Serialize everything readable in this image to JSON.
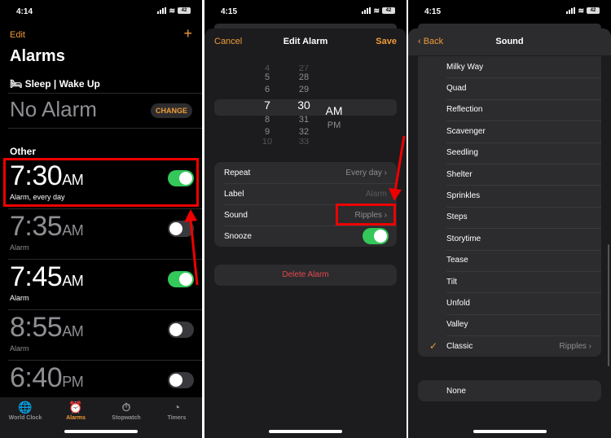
{
  "panel1": {
    "status": {
      "time": "4:14",
      "battery": "42"
    },
    "edit": "Edit",
    "add": "+",
    "title": "Alarms",
    "sleep_header": "🛏 Sleep | Wake Up",
    "no_alarm": "No Alarm",
    "change": "CHANGE",
    "other": "Other",
    "alarms": [
      {
        "time": "7:30",
        "ampm": "AM",
        "label": "Alarm, every day",
        "on": true
      },
      {
        "time": "7:35",
        "ampm": "AM",
        "label": "Alarm",
        "on": false
      },
      {
        "time": "7:45",
        "ampm": "AM",
        "label": "Alarm",
        "on": true
      },
      {
        "time": "8:55",
        "ampm": "AM",
        "label": "Alarm",
        "on": false
      },
      {
        "time": "6:40",
        "ampm": "PM",
        "label": "",
        "on": false
      }
    ],
    "tabs": [
      {
        "label": "World Clock",
        "icon": "🌐"
      },
      {
        "label": "Alarms",
        "icon": "⏰"
      },
      {
        "label": "Stopwatch",
        "icon": "⏱"
      },
      {
        "label": "Timers",
        "icon": "◔"
      }
    ]
  },
  "panel2": {
    "status": {
      "time": "4:15",
      "battery": "42"
    },
    "cancel": "Cancel",
    "title": "Edit Alarm",
    "save": "Save",
    "hours": [
      "4",
      "5",
      "6",
      "7",
      "8",
      "9",
      "10"
    ],
    "minutes": [
      "27",
      "28",
      "29",
      "30",
      "31",
      "32",
      "33"
    ],
    "ampm": [
      "AM",
      "PM"
    ],
    "rows": [
      {
        "label": "Repeat",
        "value": "Every day ›"
      },
      {
        "label": "Label",
        "value": "Alarm"
      },
      {
        "label": "Sound",
        "value": "Ripples ›"
      },
      {
        "label": "Snooze",
        "value": ""
      }
    ],
    "delete": "Delete Alarm"
  },
  "panel3": {
    "status": {
      "time": "4:15",
      "battery": "42"
    },
    "back": "‹ Back",
    "title": "Sound",
    "sounds": [
      "Milky Way",
      "Quad",
      "Reflection",
      "Scavenger",
      "Seedling",
      "Shelter",
      "Sprinkles",
      "Steps",
      "Storytime",
      "Tease",
      "Tilt",
      "Unfold",
      "Valley"
    ],
    "classic": {
      "label": "Classic",
      "value": "Ripples ›",
      "check": "✓"
    },
    "none": "None"
  },
  "colors": {
    "accent": "#f09a37",
    "toggle_on": "#34c759",
    "annotation": "#e00000"
  }
}
